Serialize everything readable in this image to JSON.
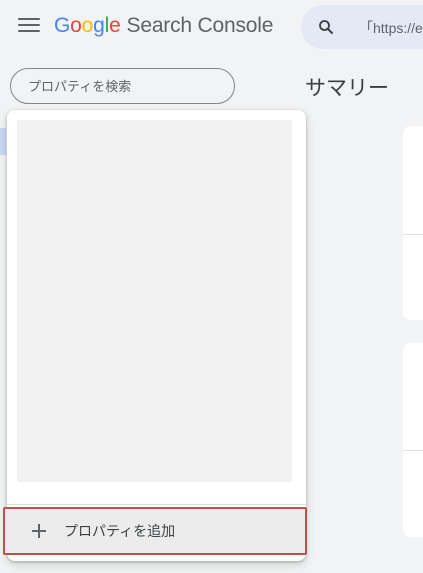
{
  "header": {
    "logo_letters": [
      "G",
      "o",
      "o",
      "g",
      "l",
      "e"
    ],
    "product_name": "Search Console",
    "url_text": "「https://e"
  },
  "sidebar": {
    "property_search": {
      "value": "",
      "placeholder": "プロパティを検索"
    }
  },
  "main": {
    "page_title": "サマリー"
  },
  "property_dropdown": {
    "add_property_label": "プロパティを追加"
  },
  "colors": {
    "accent_blue": "#4285f4",
    "highlight_border": "#c0504d",
    "page_bg": "#f1f3f4"
  }
}
